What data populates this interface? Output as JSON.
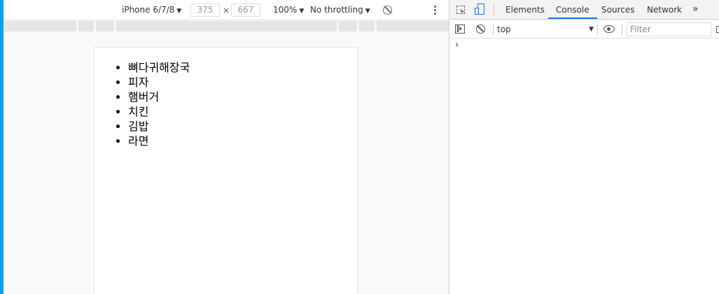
{
  "device_toolbar": {
    "device_name": "iPhone 6/7/8",
    "width": "375",
    "height": "667",
    "dim_separator": "×",
    "zoom": "100%",
    "throttling": "No throttling",
    "caret": "▼"
  },
  "page": {
    "list_items": [
      "뼈다귀해장국",
      "피자",
      "햄버거",
      "치킨",
      "김밥",
      "라면"
    ]
  },
  "devtools": {
    "tabs": [
      "Elements",
      "Console",
      "Sources",
      "Network"
    ],
    "active_tab": "Console",
    "more_tabs": "»",
    "context": "top",
    "context_caret": "▼",
    "filter_placeholder": "Filter",
    "prompt": "›"
  },
  "colors": {
    "accent_bar": "#0aa0f0",
    "active_tab_underline": "#1a73e8"
  }
}
